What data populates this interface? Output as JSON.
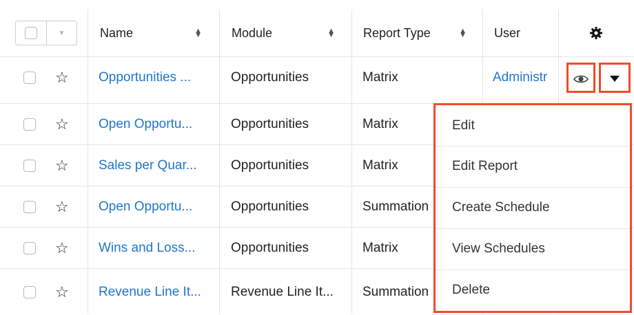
{
  "columns": {
    "name": "Name",
    "module": "Module",
    "report_type": "Report Type",
    "user": "User"
  },
  "rows": [
    {
      "name": "Opportunities ...",
      "module": "Opportunities",
      "report_type": "Matrix",
      "user": "Administr"
    },
    {
      "name": "Open Opportu...",
      "module": "Opportunities",
      "report_type": "Matrix",
      "user": ""
    },
    {
      "name": "Sales per Quar...",
      "module": "Opportunities",
      "report_type": "Matrix",
      "user": ""
    },
    {
      "name": "Open Opportu...",
      "module": "Opportunities",
      "report_type": "Summation",
      "user": ""
    },
    {
      "name": "Wins and Loss...",
      "module": "Opportunities",
      "report_type": "Matrix",
      "user": ""
    },
    {
      "name": "Revenue Line It...",
      "module": "Revenue Line It...",
      "report_type": "Summation",
      "user": ""
    }
  ],
  "action_menu": {
    "items": [
      "Edit",
      "Edit Report",
      "Create Schedule",
      "View Schedules",
      "Delete"
    ]
  },
  "colors": {
    "link": "#1f77c9",
    "highlight": "#f24a2c",
    "border": "#e4e4e4"
  },
  "icons": {
    "settings": "gear-icon",
    "favorite": "star-icon",
    "preview": "eye-icon",
    "actions": "caret-down-icon",
    "sort": "sort-icon"
  }
}
